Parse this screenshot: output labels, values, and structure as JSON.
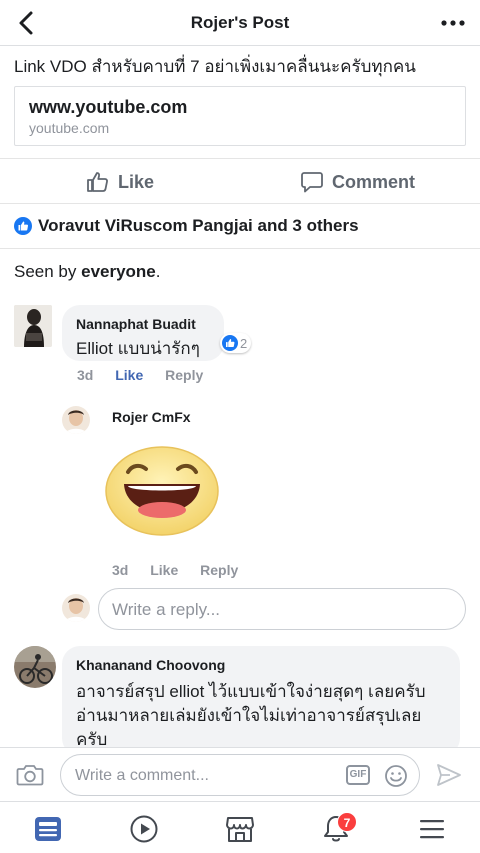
{
  "header": {
    "title": "Rojer's Post",
    "back_icon": "chevron-left-icon",
    "more_icon": "ellipsis-icon"
  },
  "post": {
    "text": "Link VDO สำหรับคาบที่ 7 อย่าเพิ่งเมาคลื่นนะครับทุกคน",
    "link_title": "www.youtube.com",
    "link_domain": "youtube.com"
  },
  "actions": {
    "like_label": "Like",
    "comment_label": "Comment"
  },
  "reactions": {
    "text": "Voravut ViRuscom Pangjai and 3 others"
  },
  "seen": {
    "prefix": "Seen by ",
    "who": "everyone",
    "suffix": "."
  },
  "comments": [
    {
      "name": "Nannaphat Buadit",
      "text": "Elliot แบบน่ารักๆ",
      "time": "3d",
      "like_label": "Like",
      "reply_label": "Reply",
      "like_count": "2"
    },
    {
      "name": "Rojer CmFx",
      "sticker": "laughing-face-sticker",
      "time": "3d",
      "like_label": "Like",
      "reply_label": "Reply"
    },
    {
      "name": "Khananand Choovong",
      "lines": [
        "อาจารย์สรุป elliot ไว้แบบเข้าใจง่ายสุดๆ เลยครับ",
        "อ่านมาหลายเล่มยังเข้าใจไม่เท่าอาจารย์สรุปเลย",
        "ครับ"
      ]
    }
  ],
  "reply_box": {
    "placeholder": "Write a reply..."
  },
  "composer": {
    "placeholder": "Write a comment...",
    "gif_label": "GIF"
  },
  "tabbar": {
    "notifications_badge": "7"
  },
  "colors": {
    "accent": "#4267b2",
    "like_blue": "#1877f2",
    "bubble": "#f2f3f5",
    "badge": "#fa3e3e"
  }
}
